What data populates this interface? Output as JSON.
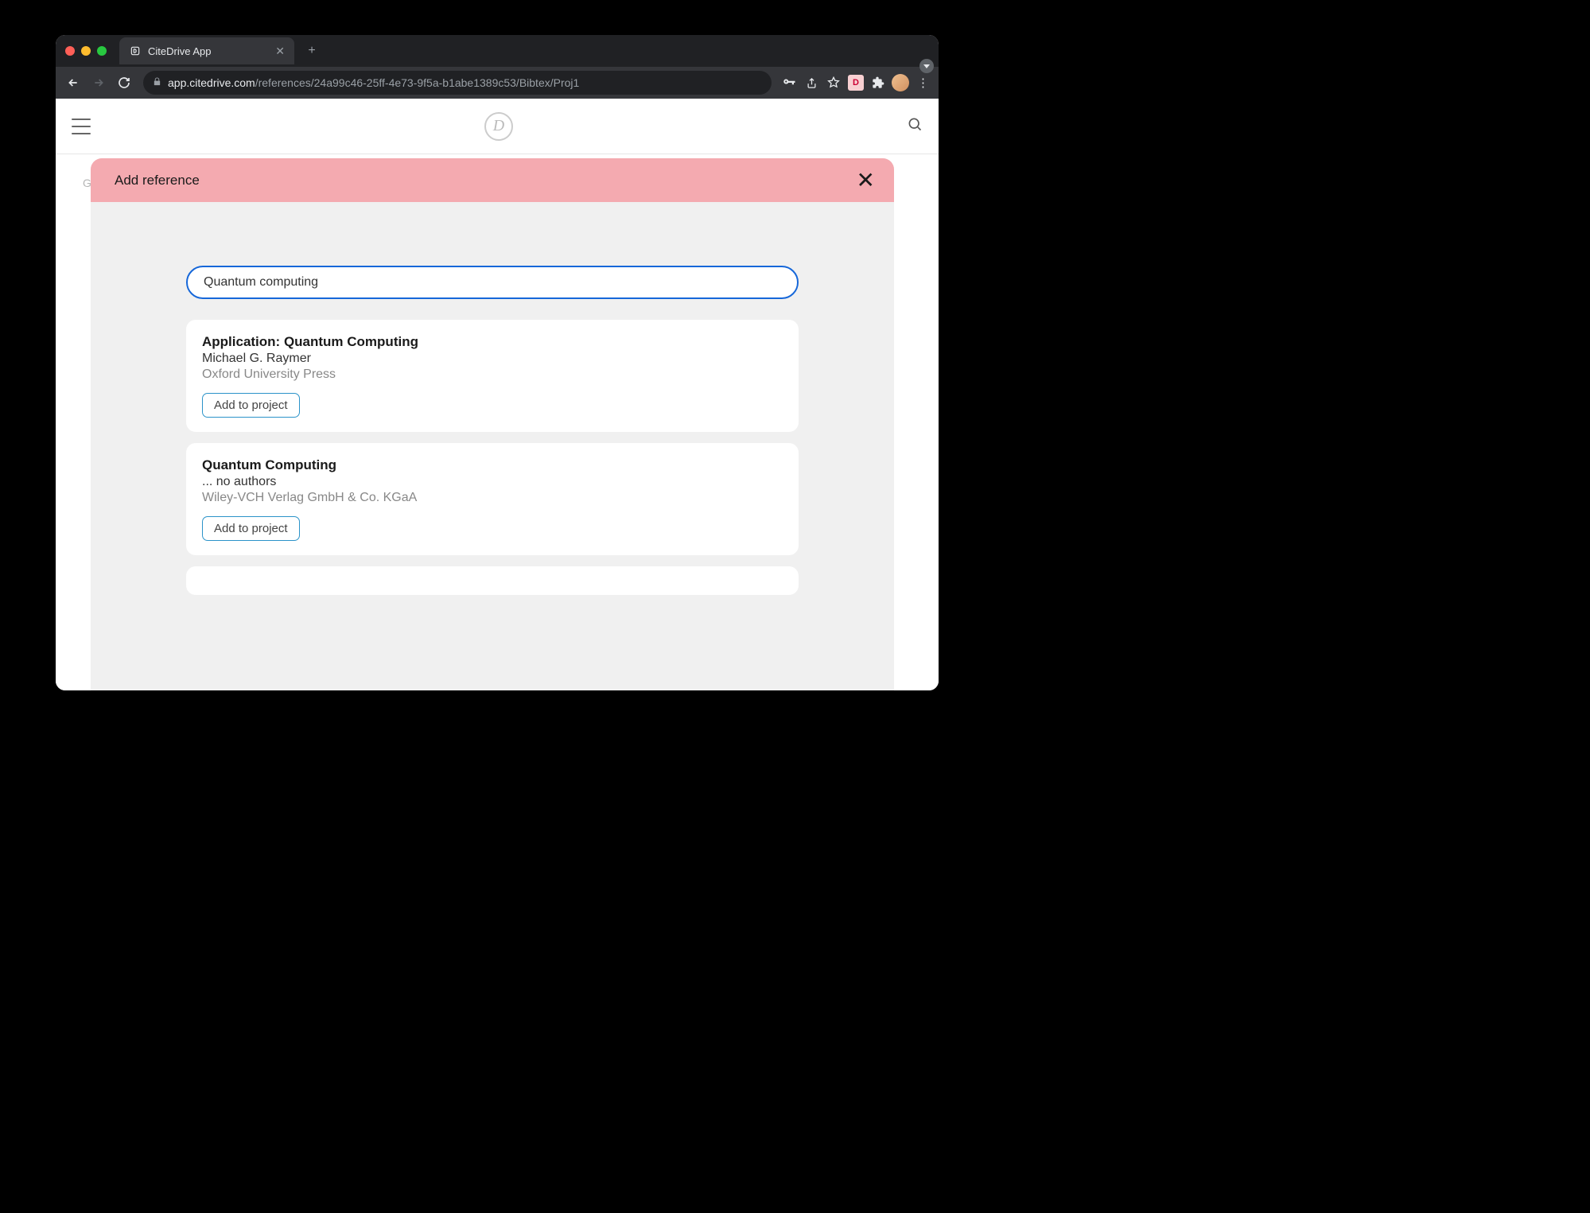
{
  "browser": {
    "tab_title": "CiteDrive App",
    "url_host": "app.citedrive.com",
    "url_path": "/references/24a99c46-25ff-4e73-9f5a-b1abe1389c53/Bibtex/Proj1"
  },
  "app": {
    "behind_label": "Gr",
    "modal_title": "Add reference",
    "search_value": "Quantum computing",
    "add_button_label": "Add to project",
    "results": [
      {
        "title": "Application: Quantum Computing",
        "author": "Michael G. Raymer",
        "publisher": "Oxford University Press"
      },
      {
        "title": "Quantum Computing",
        "author": "... no authors",
        "publisher": "Wiley-VCH Verlag GmbH & Co. KGaA"
      }
    ]
  }
}
